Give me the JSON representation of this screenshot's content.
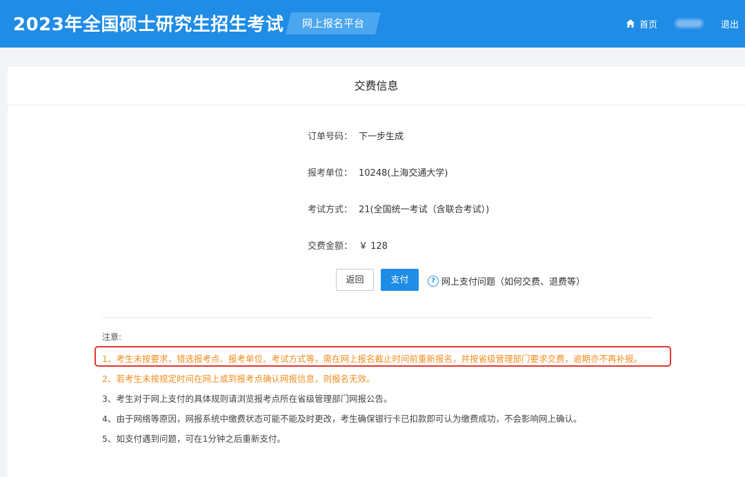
{
  "header": {
    "site_title": "2023年全国硕士研究生招生考试",
    "platform": "网上报名平台",
    "nav_home": "首页",
    "nav_logout": "退出"
  },
  "panel": {
    "title": "交费信息",
    "rows": [
      {
        "label": "订单号码：",
        "value": "下一步生成"
      },
      {
        "label": "报考单位：",
        "value": "10248(上海交通大学)"
      },
      {
        "label": "考试方式：",
        "value": "21(全国统一考试（含联合考试）)"
      },
      {
        "label": "交费金额：",
        "value": "￥ 128"
      }
    ],
    "back_label": "返回",
    "pay_label": "支付",
    "help_text": "网上支付问题（如何交费、退费等）"
  },
  "notes": {
    "title": "注意:",
    "items": [
      "1、考生未按要求，错选报考点、报考单位、考试方式等，需在网上报名截止时间前重新报名，并按省级管理部门要求交费，逾期亦不再补报。",
      "2、若考生未按规定时间在网上或到报考点确认网报信息，则报名无效。",
      "3、考生对于网上支付的具体规则请浏览报考点所在省级管理部门网报公告。",
      "4、由于网络等原因，网报系统中缴费状态可能不能及时更改，考生确保银行卡已扣款即可认为缴费成功，不会影响网上确认。",
      "5、如支付遇到问题，可在1分钟之后重新支付。"
    ]
  },
  "colors": {
    "primary": "#1f8ce6",
    "warning": "#f08c1e",
    "highlight": "#e0332a"
  }
}
